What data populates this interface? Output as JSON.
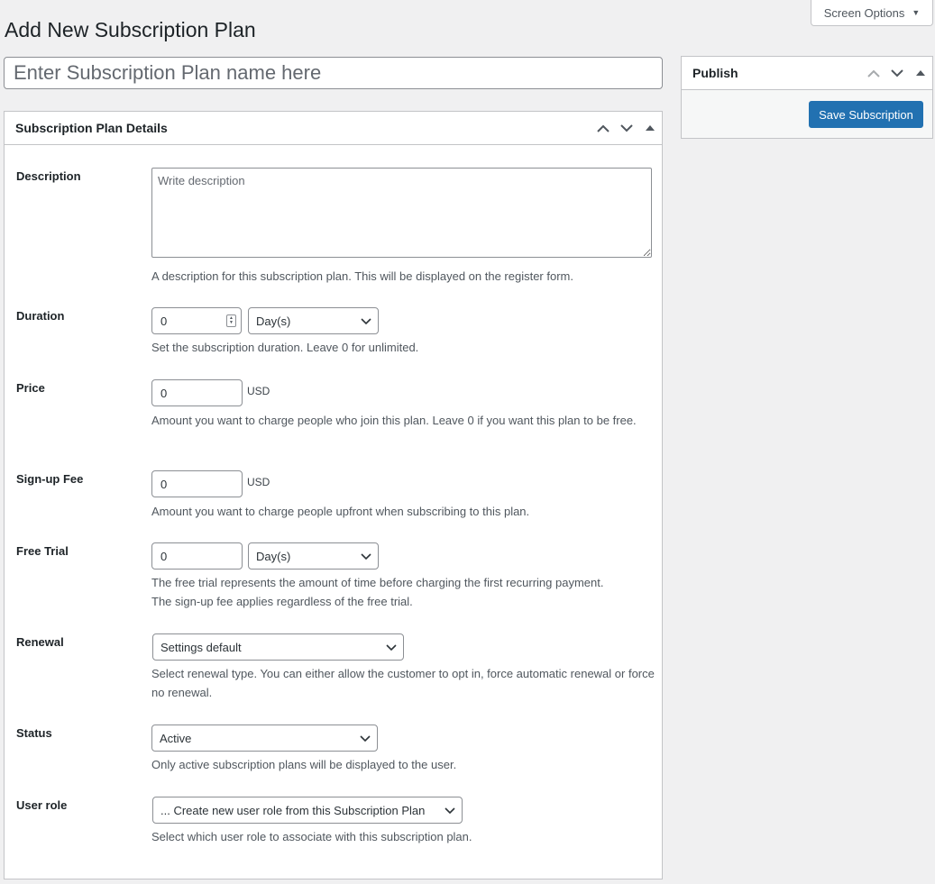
{
  "screen_options": {
    "label": "Screen Options",
    "caret_icon": "triangle-down-icon"
  },
  "page": {
    "title": "Add New Subscription Plan",
    "name_placeholder": "Enter Subscription Plan name here"
  },
  "details_box": {
    "title": "Subscription Plan Details",
    "fields": {
      "description": {
        "label": "Description",
        "placeholder": "Write description",
        "help": "A description for this subscription plan. This will be displayed on the register form."
      },
      "duration": {
        "label": "Duration",
        "value": "0",
        "unit_selected": "Day(s)",
        "help": "Set the subscription duration. Leave 0 for unlimited."
      },
      "price": {
        "label": "Price",
        "value": "0",
        "currency": "USD",
        "help": "Amount you want to charge people who join this plan. Leave 0 if you want this plan to be free."
      },
      "signup_fee": {
        "label": "Sign-up Fee",
        "value": "0",
        "currency": "USD",
        "help": "Amount you want to charge people upfront when subscribing to this plan."
      },
      "free_trial": {
        "label": "Free Trial",
        "value": "0",
        "unit_selected": "Day(s)",
        "help_line1": "The free trial represents the amount of time before charging the first recurring payment.",
        "help_line2": "The sign-up fee applies regardless of the free trial."
      },
      "renewal": {
        "label": "Renewal",
        "selected": "Settings default",
        "help": "Select renewal type. You can either allow the customer to opt in, force automatic renewal or force no renewal."
      },
      "status": {
        "label": "Status",
        "selected": "Active",
        "help": "Only active subscription plans will be displayed to the user."
      },
      "user_role": {
        "label": "User role",
        "selected": "... Create new user role from this Subscription Plan",
        "help": "Select which user role to associate with this subscription plan."
      }
    }
  },
  "publish_box": {
    "title": "Publish",
    "save_label": "Save Subscription"
  },
  "colors": {
    "primary_button": "#2271b1",
    "background": "#f0f0f1",
    "border": "#c3c4c7"
  }
}
